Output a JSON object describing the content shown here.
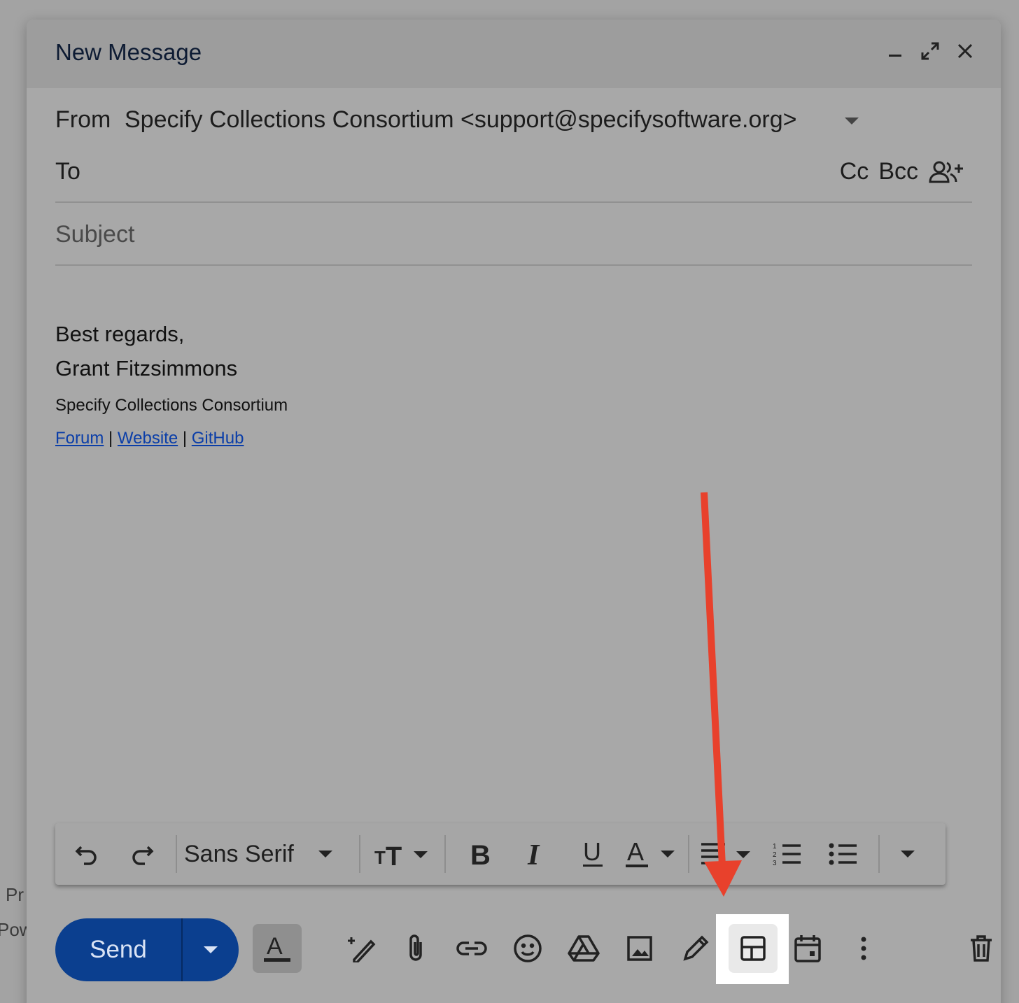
{
  "background": {
    "partial_text_1": "Pr",
    "partial_text_2": "Pow"
  },
  "compose": {
    "title": "New Message",
    "from_label": "From",
    "from_value": "Specify Collections Consortium <support@specifysoftware.org>",
    "to_label": "To",
    "cc_label": "Cc",
    "bcc_label": "Bcc",
    "subject_placeholder": "Subject"
  },
  "signature": {
    "line1": "Best regards,",
    "line2": "Grant Fitzsimmons",
    "line3": "Specify Collections Consortium",
    "links": [
      "Forum",
      "Website",
      "GitHub"
    ],
    "separator": "|"
  },
  "formatting_toolbar": {
    "font_name": "Sans Serif",
    "icons": [
      "undo-icon",
      "redo-icon",
      "font-caret-icon",
      "text-size-icon",
      "bold-icon",
      "italic-icon",
      "underline-icon",
      "text-color-icon",
      "align-icon",
      "numbered-list-icon",
      "bulleted-list-icon",
      "more-formatting-icon"
    ]
  },
  "bottom_toolbar": {
    "send_label": "Send",
    "icons": [
      "formatting-options-icon",
      "help-me-write-icon",
      "attach-icon",
      "link-icon",
      "emoji-icon",
      "drive-icon",
      "photo-icon",
      "signature-icon",
      "layouts-icon",
      "schedule-icon",
      "more-options-icon",
      "discard-icon"
    ],
    "highlighted": "layouts-icon"
  },
  "colors": {
    "send_button": "#0b3f8f",
    "arrow": "#e8412c",
    "link": "#0b3ea8",
    "highlight": "#ffffff"
  }
}
